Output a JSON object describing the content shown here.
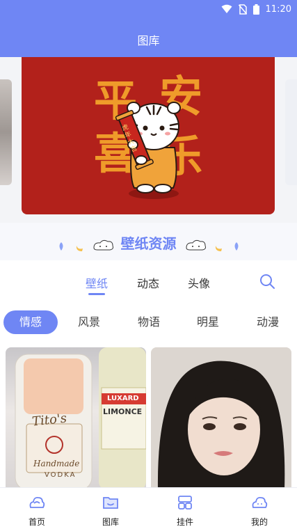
{
  "status_bar": {
    "time": "11:20"
  },
  "app_bar": {
    "title": "图库"
  },
  "banner": {
    "chars": [
      "平",
      "安",
      "喜",
      "乐"
    ],
    "scroll_text": "虎年大吉",
    "colors": {
      "background": "#b2211b",
      "text": "#ef9b2a"
    }
  },
  "section": {
    "title": "壁纸资源"
  },
  "tabs": [
    {
      "label": "壁纸",
      "active": true
    },
    {
      "label": "动态",
      "active": false
    },
    {
      "label": "头像",
      "active": false
    }
  ],
  "search_icon": "search-icon",
  "categories": [
    {
      "label": "情感",
      "active": true
    },
    {
      "label": "风景",
      "active": false
    },
    {
      "label": "物语",
      "active": false
    },
    {
      "label": "明星",
      "active": false
    },
    {
      "label": "动漫",
      "active": false
    }
  ],
  "cards": [
    {
      "bottle_text_1": "Tito's",
      "bottle_text_2": "Handmade",
      "bottle_text_3": "VODKA",
      "label_text_1": "LUXARD",
      "label_text_2": "LIMONCE"
    },
    {
      "subject": "portrait"
    }
  ],
  "bottom_nav": [
    {
      "label": "首页",
      "icon": "home-cloud-icon",
      "active": false
    },
    {
      "label": "图库",
      "icon": "folder-icon",
      "active": true
    },
    {
      "label": "挂件",
      "icon": "widgets-icon",
      "active": false
    },
    {
      "label": "我的",
      "icon": "profile-cloud-icon",
      "active": false
    }
  ],
  "accent_color": "#6f86f4"
}
